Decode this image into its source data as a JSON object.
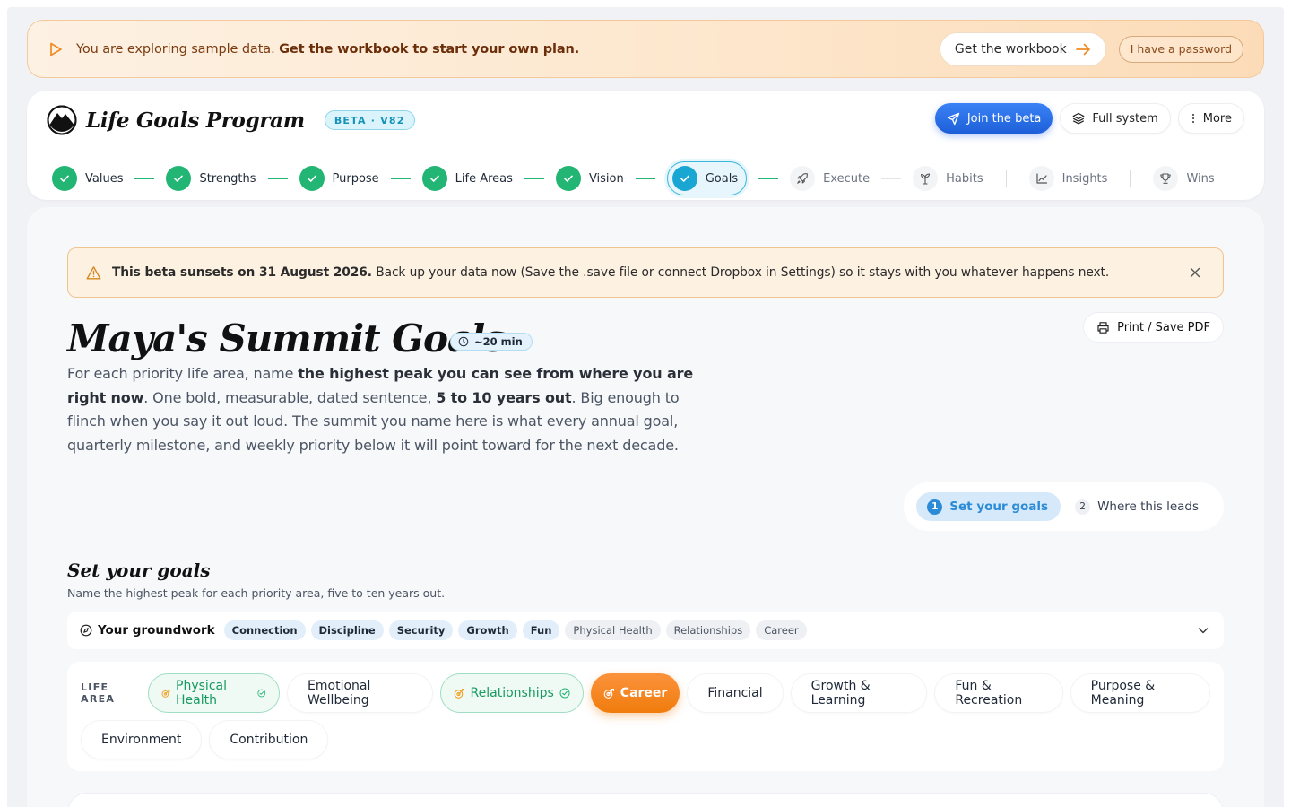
{
  "sample_banner": {
    "text": "You are exploring sample data.",
    "emphasis": "Get the workbook to start your own plan.",
    "workbook_button": "Get the workbook",
    "password_button": "I have a password"
  },
  "header": {
    "brand": "Life Goals Program",
    "badge": "BETA · V82",
    "join_button": "Join the beta",
    "full_system_button": "Full system",
    "more_button": "More"
  },
  "steps": [
    {
      "label": "Values",
      "state": "done"
    },
    {
      "label": "Strengths",
      "state": "done"
    },
    {
      "label": "Purpose",
      "state": "done"
    },
    {
      "label": "Life Areas",
      "state": "done"
    },
    {
      "label": "Vision",
      "state": "done"
    },
    {
      "label": "Goals",
      "state": "current"
    },
    {
      "label": "Execute",
      "state": "pending"
    },
    {
      "label": "Habits",
      "state": "pending"
    },
    {
      "label": "Insights",
      "state": "pending"
    },
    {
      "label": "Wins",
      "state": "pending"
    }
  ],
  "alert": {
    "bold": "This beta sunsets on 31 August 2026.",
    "text": "Back up your data now (Save the .save file or connect Dropbox in Settings) so it stays with you whatever happens next."
  },
  "page": {
    "title": "Maya's Summit Goals",
    "time": "~20 min",
    "print_button": "Print / Save PDF",
    "intro": {
      "p1": "For each priority life area, name ",
      "b1": "the highest peak you can see from where you are right now",
      "p2": ". One bold, measurable, dated sentence, ",
      "b2": "5 to 10 years out",
      "p3": ". Big enough to flinch when you say it out loud. The summit you name here is what every annual goal, quarterly milestone, and weekly priority below it will point toward for the next decade."
    }
  },
  "subtabs": [
    {
      "num": "1",
      "label": "Set your goals",
      "active": true
    },
    {
      "num": "2",
      "label": "Where this leads",
      "active": false
    }
  ],
  "section": {
    "title": "Set your goals",
    "subtitle": "Name the highest peak for each priority area, five to ten years out."
  },
  "groundwork": {
    "label": "Your groundwork",
    "values": [
      "Connection",
      "Discipline",
      "Security",
      "Growth",
      "Fun"
    ],
    "areas": [
      "Physical Health",
      "Relationships",
      "Career"
    ]
  },
  "life_area": {
    "label": "LIFE AREA",
    "items": [
      {
        "label": "Physical Health",
        "state": "done"
      },
      {
        "label": "Emotional Wellbeing",
        "state": "plain"
      },
      {
        "label": "Relationships",
        "state": "done"
      },
      {
        "label": "Career",
        "state": "selected"
      },
      {
        "label": "Financial",
        "state": "plain"
      },
      {
        "label": "Growth & Learning",
        "state": "plain"
      },
      {
        "label": "Fun & Recreation",
        "state": "plain"
      },
      {
        "label": "Purpose & Meaning",
        "state": "plain"
      },
      {
        "label": "Environment",
        "state": "plain"
      },
      {
        "label": "Contribution",
        "state": "plain"
      }
    ]
  },
  "colors": {
    "accent_green": "#22b573",
    "accent_blue": "#2563eb",
    "accent_orange": "#f07c0c",
    "current_step": "#1aa6d3"
  }
}
